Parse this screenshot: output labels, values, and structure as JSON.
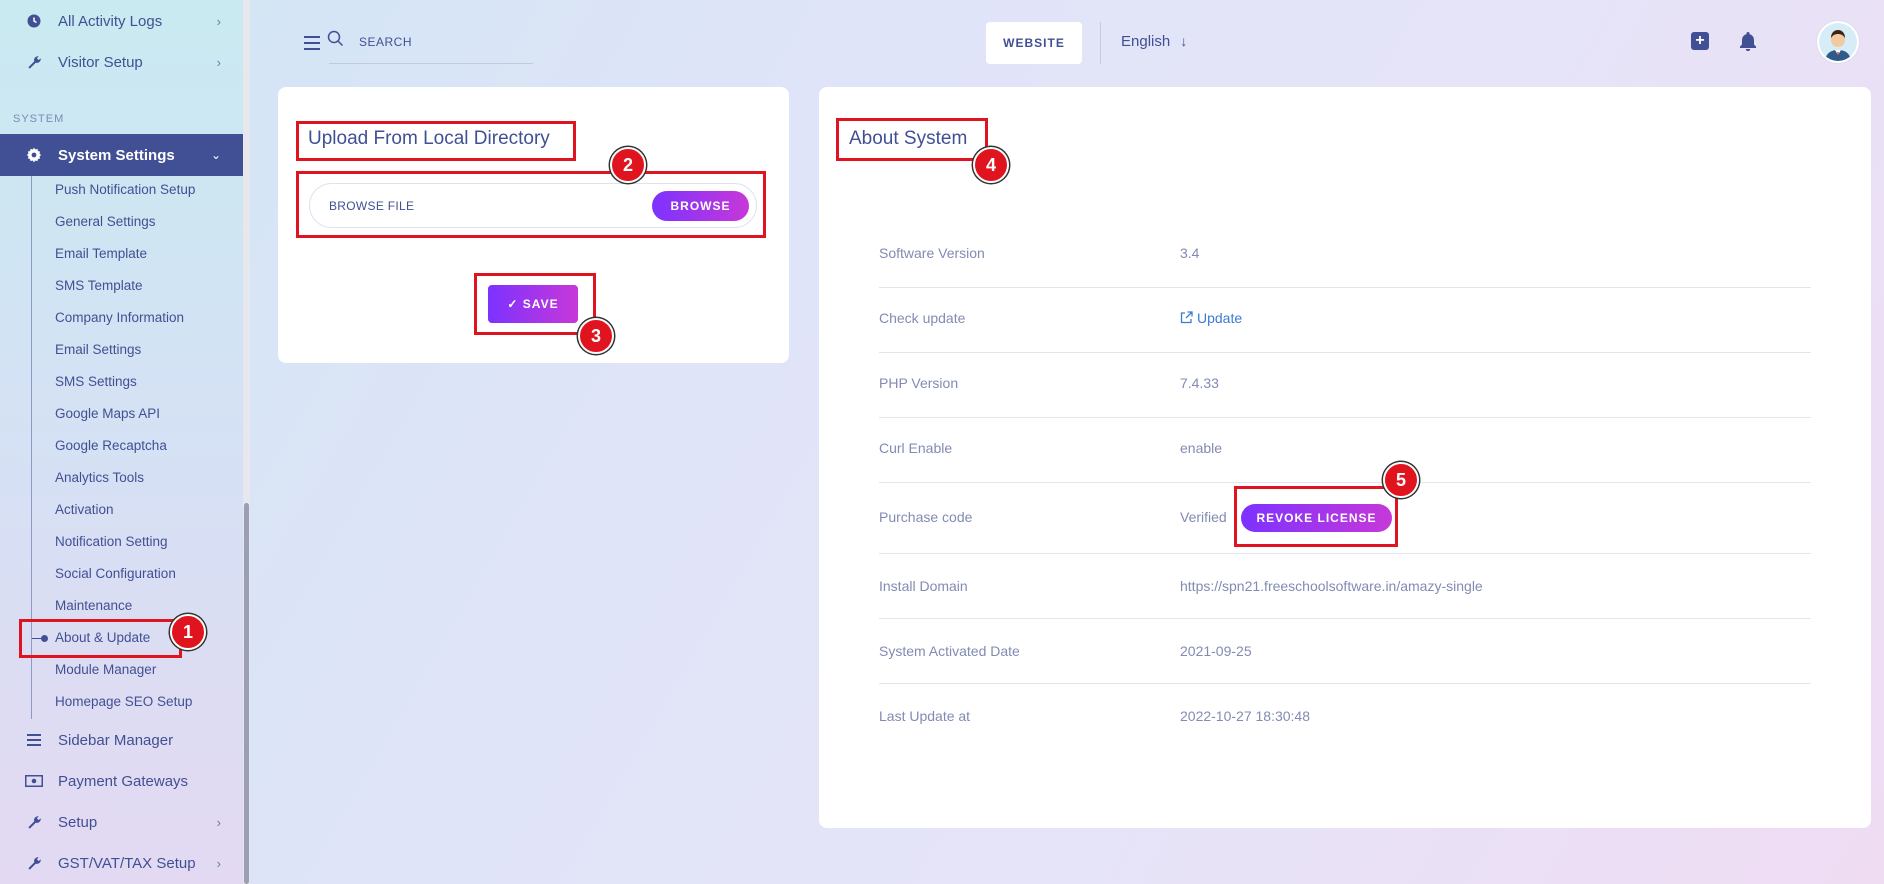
{
  "sidebar": {
    "items_top": [
      {
        "label": "All Activity Logs",
        "icon": "clock-icon"
      },
      {
        "label": "Visitor Setup",
        "icon": "wrench-icon"
      }
    ],
    "section_label": "SYSTEM",
    "active_item": {
      "label": "System Settings",
      "icon": "gear-icon"
    },
    "sub_items": [
      "Push Notification Setup",
      "General Settings",
      "Email Template",
      "SMS Template",
      "Company Information",
      "Email Settings",
      "SMS Settings",
      "Google Maps API",
      "Google Recaptcha",
      "Analytics Tools",
      "Activation",
      "Notification Setting",
      "Social Configuration",
      "Maintenance",
      "About & Update",
      "Module Manager",
      "Homepage SEO Setup"
    ],
    "active_sub_item": "About & Update",
    "items_bottom": [
      {
        "label": "Sidebar Manager",
        "icon": "list-icon"
      },
      {
        "label": "Payment Gateways",
        "icon": "money-icon"
      },
      {
        "label": "Setup",
        "icon": "wrench-icon"
      },
      {
        "label": "GST/VAT/TAX Setup",
        "icon": "wrench-icon"
      }
    ]
  },
  "header": {
    "search_placeholder": "SEARCH",
    "website_label": "WEBSITE",
    "language": "English"
  },
  "upload_card": {
    "title": "Upload From Local Directory",
    "browse_placeholder": "BROWSE FILE",
    "browse_button": "BROWSE",
    "save_button": "SAVE"
  },
  "about_card": {
    "title": "About System",
    "rows": [
      {
        "key": "Software Version",
        "value": "3.4"
      },
      {
        "key": "Check update",
        "value": "Update"
      },
      {
        "key": "PHP Version",
        "value": "7.4.33"
      },
      {
        "key": "Curl Enable",
        "value": "enable"
      },
      {
        "key": "Purchase code",
        "value": "Verified"
      },
      {
        "key": "Install Domain",
        "value": "https://spn21.freeschoolsoftware.in/amazy-single"
      },
      {
        "key": "System Activated Date",
        "value": "2021-09-25"
      },
      {
        "key": "Last Update at",
        "value": "2022-10-27 18:30:48"
      }
    ],
    "revoke_button": "REVOKE LICENSE"
  },
  "annotations": [
    "1",
    "2",
    "3",
    "4",
    "5"
  ],
  "colors": {
    "primary": "#415094",
    "accent_gradient_start": "#7c32ff",
    "accent_gradient_end": "#c738d8",
    "annotation_red": "#e0141e"
  }
}
